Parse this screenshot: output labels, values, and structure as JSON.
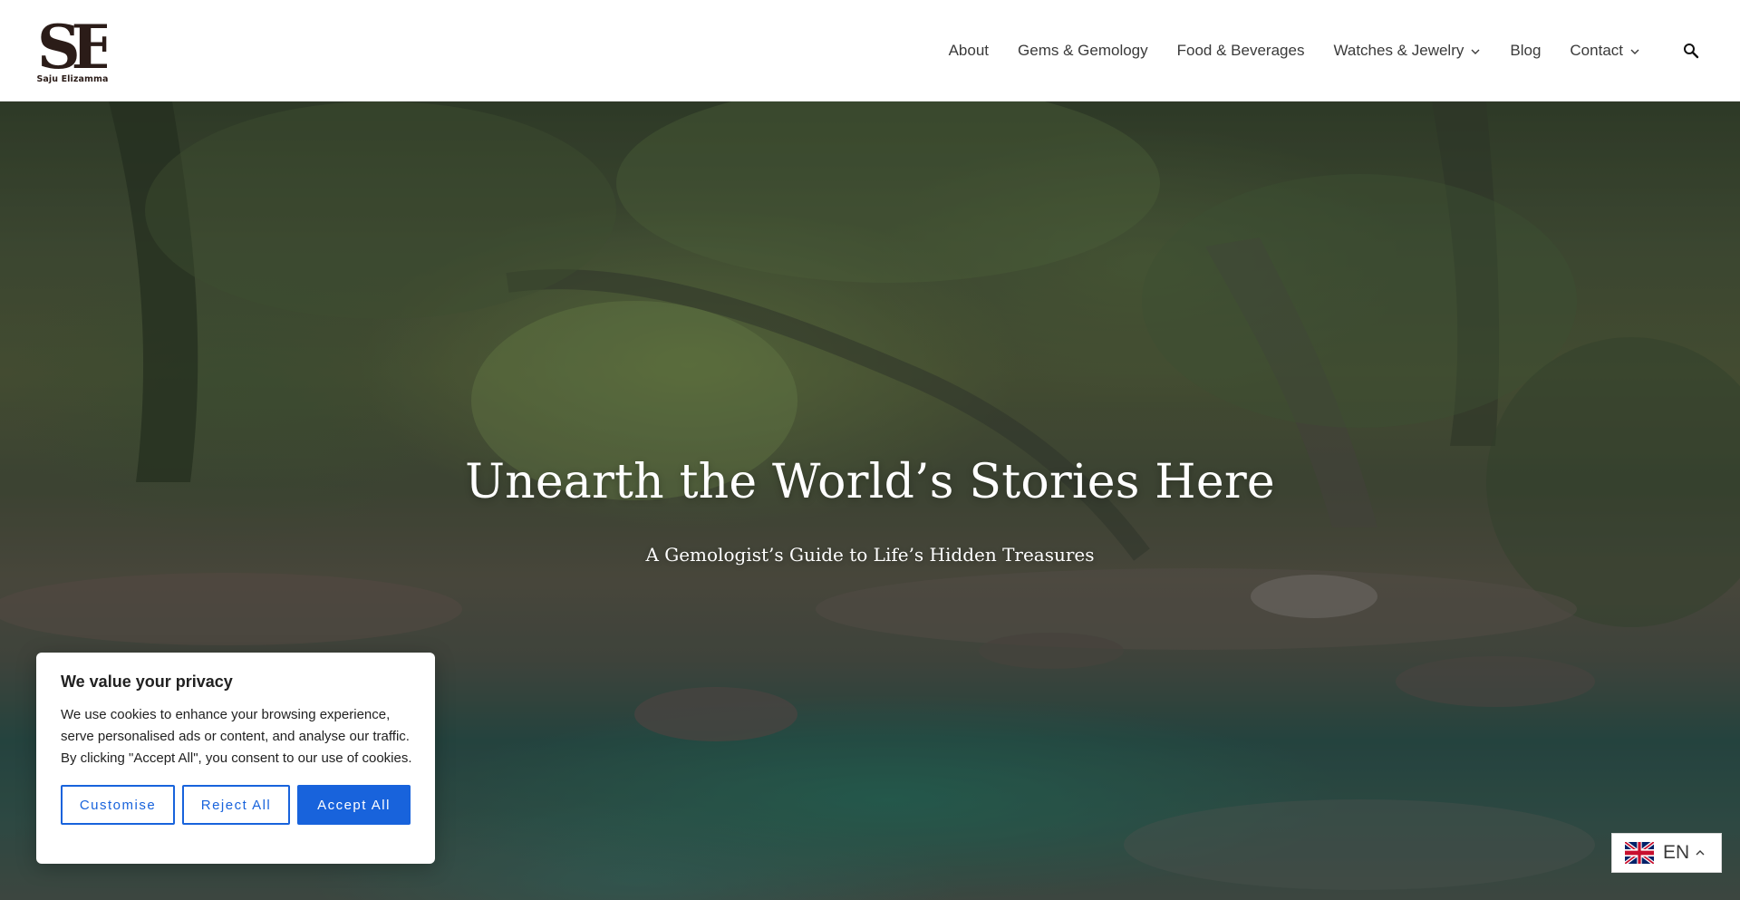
{
  "header": {
    "logo": {
      "initials": "SE",
      "caption": "Saju Elizamma"
    },
    "nav": [
      {
        "label": "About",
        "has_dropdown": false
      },
      {
        "label": "Gems & Gemology",
        "has_dropdown": false
      },
      {
        "label": "Food & Beverages",
        "has_dropdown": false
      },
      {
        "label": "Watches & Jewelry",
        "has_dropdown": true
      },
      {
        "label": "Blog",
        "has_dropdown": false
      },
      {
        "label": "Contact",
        "has_dropdown": true
      }
    ],
    "search_icon": "search-icon"
  },
  "hero": {
    "title": "Unearth the World’s Stories Here",
    "subtitle": "A Gemologist’s Guide to Life’s Hidden Treasures"
  },
  "cookie": {
    "title": "We value your privacy",
    "text": "We use cookies to enhance your browsing experience, serve personalised ads or content, and analyse our traffic. By clicking \"Accept All\", you consent to our use of cookies.",
    "customise_label": "Customise",
    "reject_label": "Reject All",
    "accept_label": "Accept All"
  },
  "language": {
    "code": "EN",
    "flag_icon": "uk-flag-icon"
  },
  "colors": {
    "accent": "#1863dc",
    "nav_text": "#3a3a3a",
    "logo": "#2b1c18"
  }
}
